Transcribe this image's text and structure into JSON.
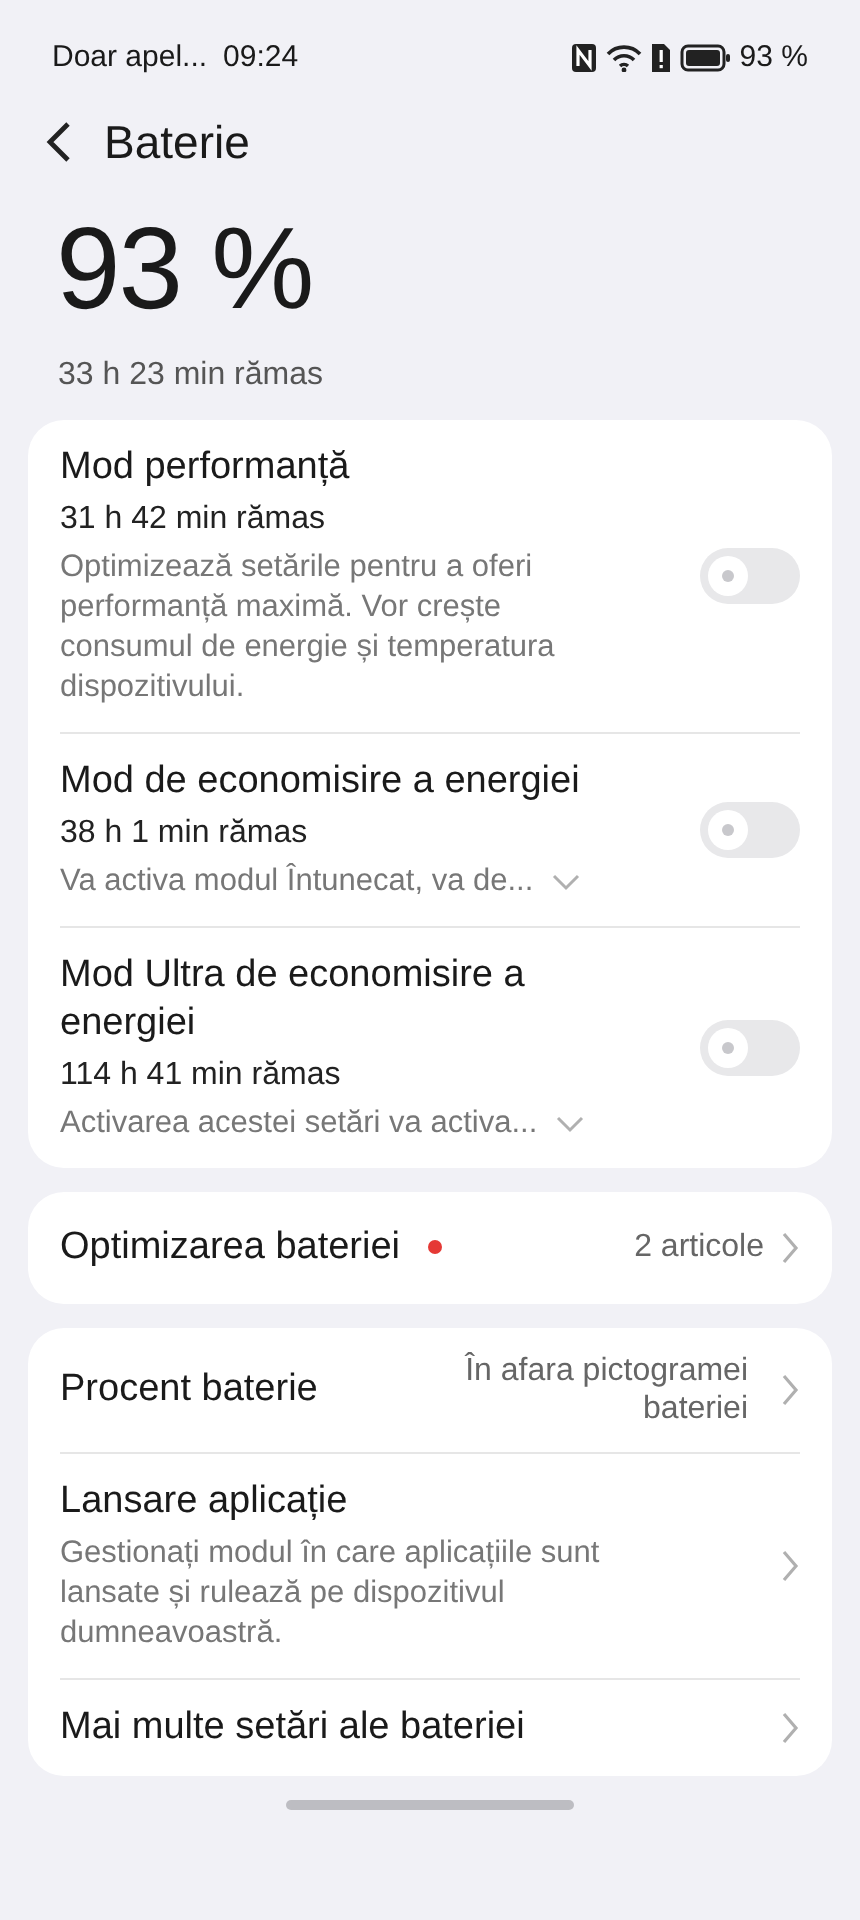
{
  "status_bar": {
    "carrier": "Doar apel...",
    "time": "09:24",
    "battery_percent": "93 %"
  },
  "header": {
    "title": "Baterie"
  },
  "summary": {
    "percent": "93 %",
    "remaining": "33 h 23 min rămas"
  },
  "modes": [
    {
      "title": "Mod performanță",
      "remaining": "31 h 42 min rămas",
      "description": "Optimizează setările pentru a oferi performanță maximă. Vor crește consumul de energie și temperatura dispozitivului.",
      "expandable": false,
      "on": false
    },
    {
      "title": "Mod de economisire a energiei",
      "remaining": "38 h 1 min rămas",
      "description": "Va activa modul Întunecat, va de...",
      "expandable": true,
      "on": false
    },
    {
      "title": "Mod Ultra de economisire a energiei",
      "remaining": "114 h 41 min rămas",
      "description": "Activarea acestei setări va activa...",
      "expandable": true,
      "on": false
    }
  ],
  "optimization": {
    "title": "Optimizarea bateriei",
    "color": "#e53935",
    "value": "2 articole"
  },
  "settings": [
    {
      "title": "Procent baterie",
      "value": "În afara pictogramei bateriei"
    },
    {
      "title": "Lansare aplicație",
      "description": "Gestionați modul în care aplicațiile sunt lansate și rulează pe dispozitivul dumneavoastră."
    },
    {
      "title": "Mai multe setări ale bateriei"
    }
  ]
}
